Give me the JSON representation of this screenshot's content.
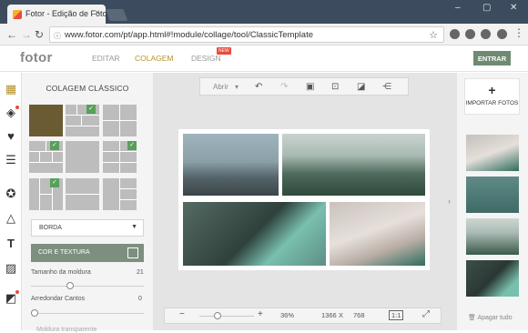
{
  "browser": {
    "tab_title": "Fotor - Edição de Fotos",
    "url": "www.fotor.com/pt/app.html#!module/collage/tool/ClassicTemplate",
    "window_minimize": "–",
    "window_maximize": "▢",
    "window_close": "✕"
  },
  "app": {
    "logo": "fotor",
    "menu": {
      "editar": "EDITAR",
      "colagem": "COLAGEM",
      "design": "DESIGN",
      "new_badge": "NEW"
    },
    "login": "ENTRAR"
  },
  "panel": {
    "title": "COLAGEM CLÁSSICO",
    "border_dropdown": "BORDA",
    "color_texture": "COR E TEXTURA",
    "frame_size_label": "Tamanho da moldura",
    "frame_size_value": "21",
    "frame_size_level": 0.35,
    "round_corners_label": "Arredondar Cantos",
    "round_corners_value": "0",
    "round_corners_level": 0.0,
    "shadow_label": "Moldura transparente"
  },
  "toolbar": {
    "open": "Abrir"
  },
  "zoom": {
    "percent": "36%",
    "width": "1366",
    "x": "X",
    "height": "768",
    "ratio": "1:1",
    "minus": "−",
    "plus": "+"
  },
  "right": {
    "import": "IMPORTAR FOTOS",
    "clear": "Apagar tudo"
  },
  "icons": {
    "left_tools": [
      "collage-layout-icon",
      "sticker-icon",
      "heart-icon",
      "template-icon",
      "badge-icon",
      "shape-icon",
      "text-icon",
      "pattern-icon",
      "ratio-icon"
    ],
    "top_tools": [
      "undo-icon",
      "redo-icon",
      "image-icon",
      "crop-icon",
      "flip-icon",
      "share-icon"
    ]
  },
  "colors": {
    "accent": "#b4912a",
    "primary_button": "#6f8a72",
    "new_badge": "#e74c3c",
    "check": "#57a05a"
  }
}
